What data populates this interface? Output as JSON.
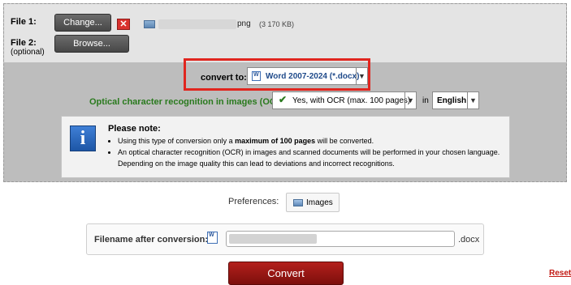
{
  "file1": {
    "label": "File 1:",
    "button": "Change...",
    "remove_icon": "close-icon",
    "filename_ext": "png",
    "size": "(3 170 KB)"
  },
  "file2": {
    "label": "File 2:",
    "sublabel": "(optional)",
    "button": "Browse..."
  },
  "convert_to": {
    "label": "convert to:",
    "value": "Word 2007-2024 (*.docx)"
  },
  "ocr": {
    "label": "Optical character recognition in images (OCR):",
    "value": "Yes, with OCR (max. 100 pages)",
    "in_label": "in",
    "language": "English"
  },
  "note": {
    "title": "Please note:",
    "bullet1_pre": "Using this type of conversion only a ",
    "bullet1_bold": "maximum of 100 pages",
    "bullet1_post": " will be converted.",
    "bullet2": "An optical character recognition (OCR) in images and scanned documents will be performed in your chosen language. Depending on the image quality this can lead to deviations and incorrect recognitions."
  },
  "preferences": {
    "label": "Preferences:",
    "button": "Images"
  },
  "filename": {
    "label": "Filename after conversion:",
    "extension": ".docx"
  },
  "actions": {
    "convert": "Convert",
    "reset": "Reset"
  },
  "colors": {
    "highlight_border": "#e0261f",
    "convert_button": "#9b1612",
    "ocr_text": "#2a7a1e",
    "reset_link": "#c21a14"
  }
}
